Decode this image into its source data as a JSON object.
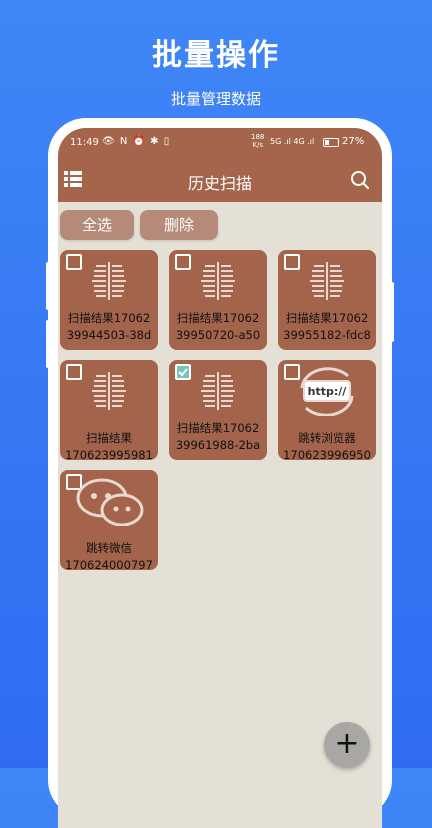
{
  "promo": {
    "title": "批量操作",
    "subtitle": "批量管理数据"
  },
  "status_bar": {
    "time": "11:49",
    "icons": "👁 N ⏰ ✱ ▯",
    "speed_value": "188",
    "speed_unit": "K/s",
    "network": "5G .ıl 4G .ıl",
    "battery": "27%"
  },
  "app_bar": {
    "title": "历史扫描",
    "menu_icon": "list-menu-icon",
    "search_icon": "search-icon"
  },
  "actions": {
    "select_all": "全选",
    "delete": "删除"
  },
  "items": [
    {
      "line1": "扫描结果17062",
      "line2": "39944503-38d",
      "icon": "barcode-icon",
      "checked": false
    },
    {
      "line1": "扫描结果17062",
      "line2": "39950720-a50",
      "icon": "barcode-icon",
      "checked": false
    },
    {
      "line1": "扫描结果17062",
      "line2": "39955182-fdc8",
      "icon": "barcode-icon",
      "checked": false
    },
    {
      "line1": "扫描结果",
      "line2": "170623995981",
      "icon": "barcode-icon",
      "checked": false
    },
    {
      "line1": "扫描结果17062",
      "line2": "39961988-2ba",
      "icon": "barcode-icon",
      "checked": true
    },
    {
      "line1": "跳转浏览器",
      "line2": "170623996950",
      "icon": "browser-http-icon",
      "checked": false
    },
    {
      "line1": "跳转微信",
      "line2": "170624000797",
      "icon": "wechat-icon",
      "checked": false
    }
  ],
  "fab": {
    "label": "+"
  },
  "colors": {
    "accent": "#a5654b",
    "tile": "#a3644b",
    "background": "#e5e0d6",
    "button": "#b68a78",
    "promo_bg": "#3f86f7"
  }
}
